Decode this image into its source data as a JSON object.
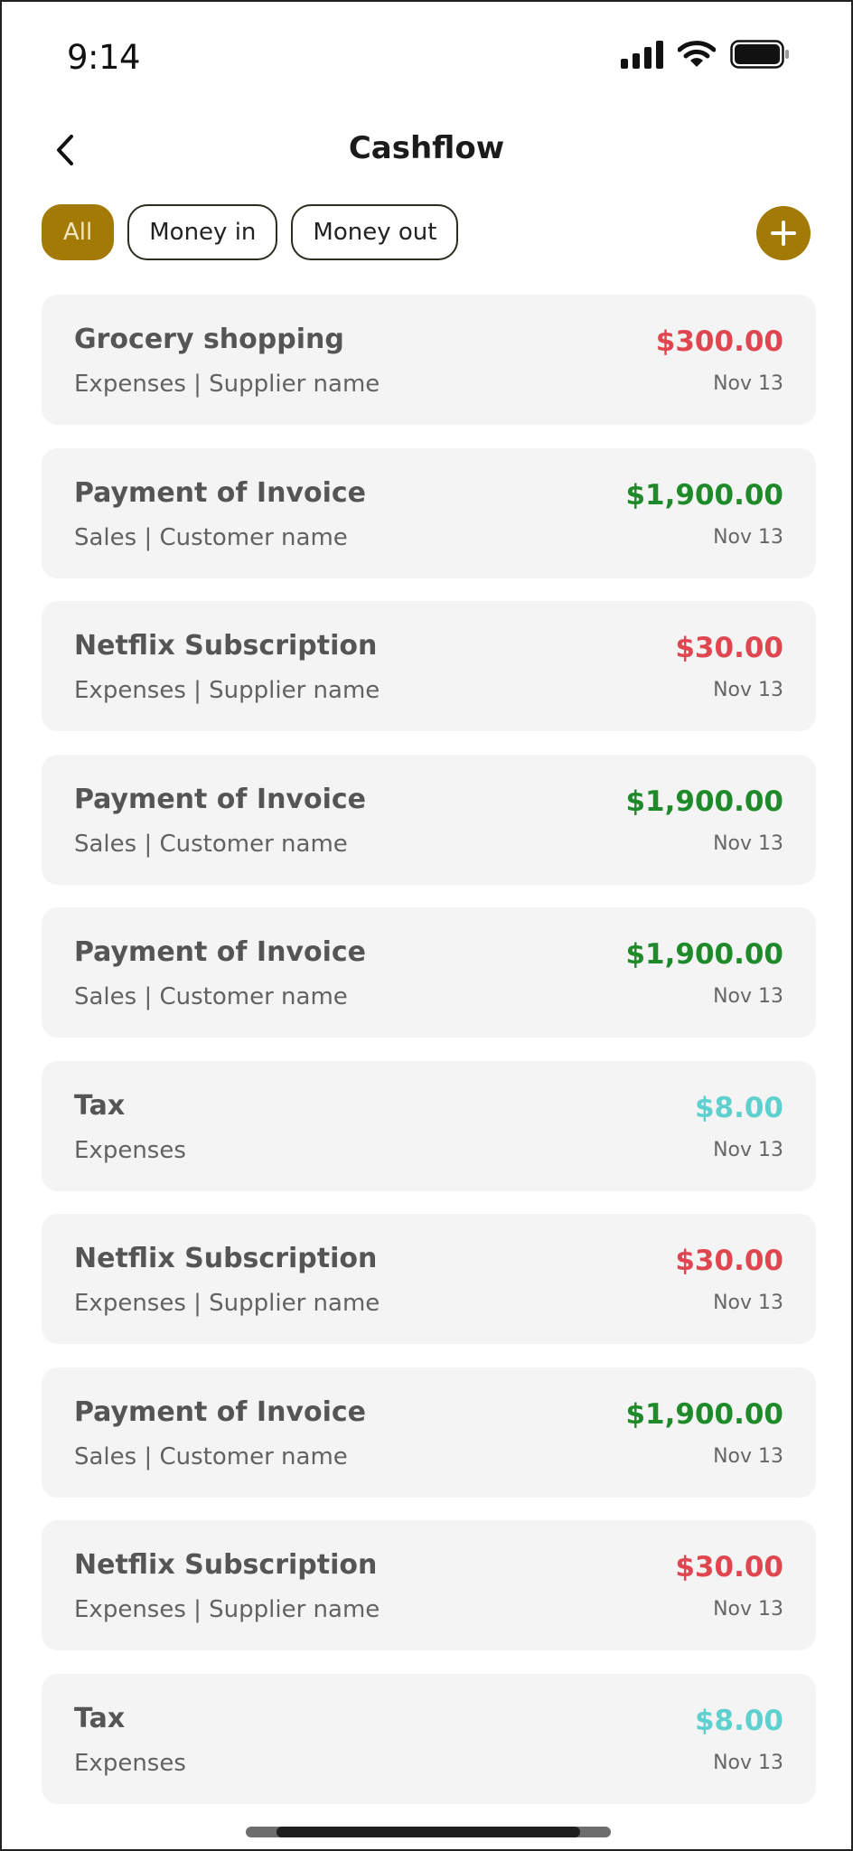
{
  "status_bar": {
    "time": "9:14"
  },
  "header": {
    "title": "Cashflow"
  },
  "filters": [
    {
      "label": "All",
      "active": true
    },
    {
      "label": "Money in",
      "active": false
    },
    {
      "label": "Money out",
      "active": false
    }
  ],
  "colors": {
    "accent": "#a37a05",
    "expense": "#e0464f",
    "income": "#1f8a2a",
    "tax": "#5fd0d0"
  },
  "transactions": [
    {
      "title": "Grocery shopping",
      "subtitle": "Expenses | Supplier name",
      "amount": "$300.00",
      "date": "Nov 13",
      "type": "expense"
    },
    {
      "title": "Payment of Invoice",
      "subtitle": "Sales | Customer name",
      "amount": "$1,900.00",
      "date": "Nov 13",
      "type": "income"
    },
    {
      "title": "Netflix Subscription",
      "subtitle": "Expenses | Supplier name",
      "amount": "$30.00",
      "date": "Nov 13",
      "type": "expense"
    },
    {
      "title": "Payment of Invoice",
      "subtitle": "Sales | Customer name",
      "amount": "$1,900.00",
      "date": "Nov 13",
      "type": "income"
    },
    {
      "title": "Payment of Invoice",
      "subtitle": "Sales | Customer name",
      "amount": "$1,900.00",
      "date": "Nov 13",
      "type": "income"
    },
    {
      "title": "Tax",
      "subtitle": "Expenses",
      "amount": "$8.00",
      "date": "Nov 13",
      "type": "tax"
    },
    {
      "title": "Netflix Subscription",
      "subtitle": "Expenses | Supplier name",
      "amount": "$30.00",
      "date": "Nov 13",
      "type": "expense"
    },
    {
      "title": "Payment of Invoice",
      "subtitle": "Sales | Customer name",
      "amount": "$1,900.00",
      "date": "Nov 13",
      "type": "income"
    },
    {
      "title": "Netflix Subscription",
      "subtitle": "Expenses | Supplier name",
      "amount": "$30.00",
      "date": "Nov 13",
      "type": "expense"
    },
    {
      "title": "Tax",
      "subtitle": "Expenses",
      "amount": "$8.00",
      "date": "Nov 13",
      "type": "tax"
    }
  ]
}
